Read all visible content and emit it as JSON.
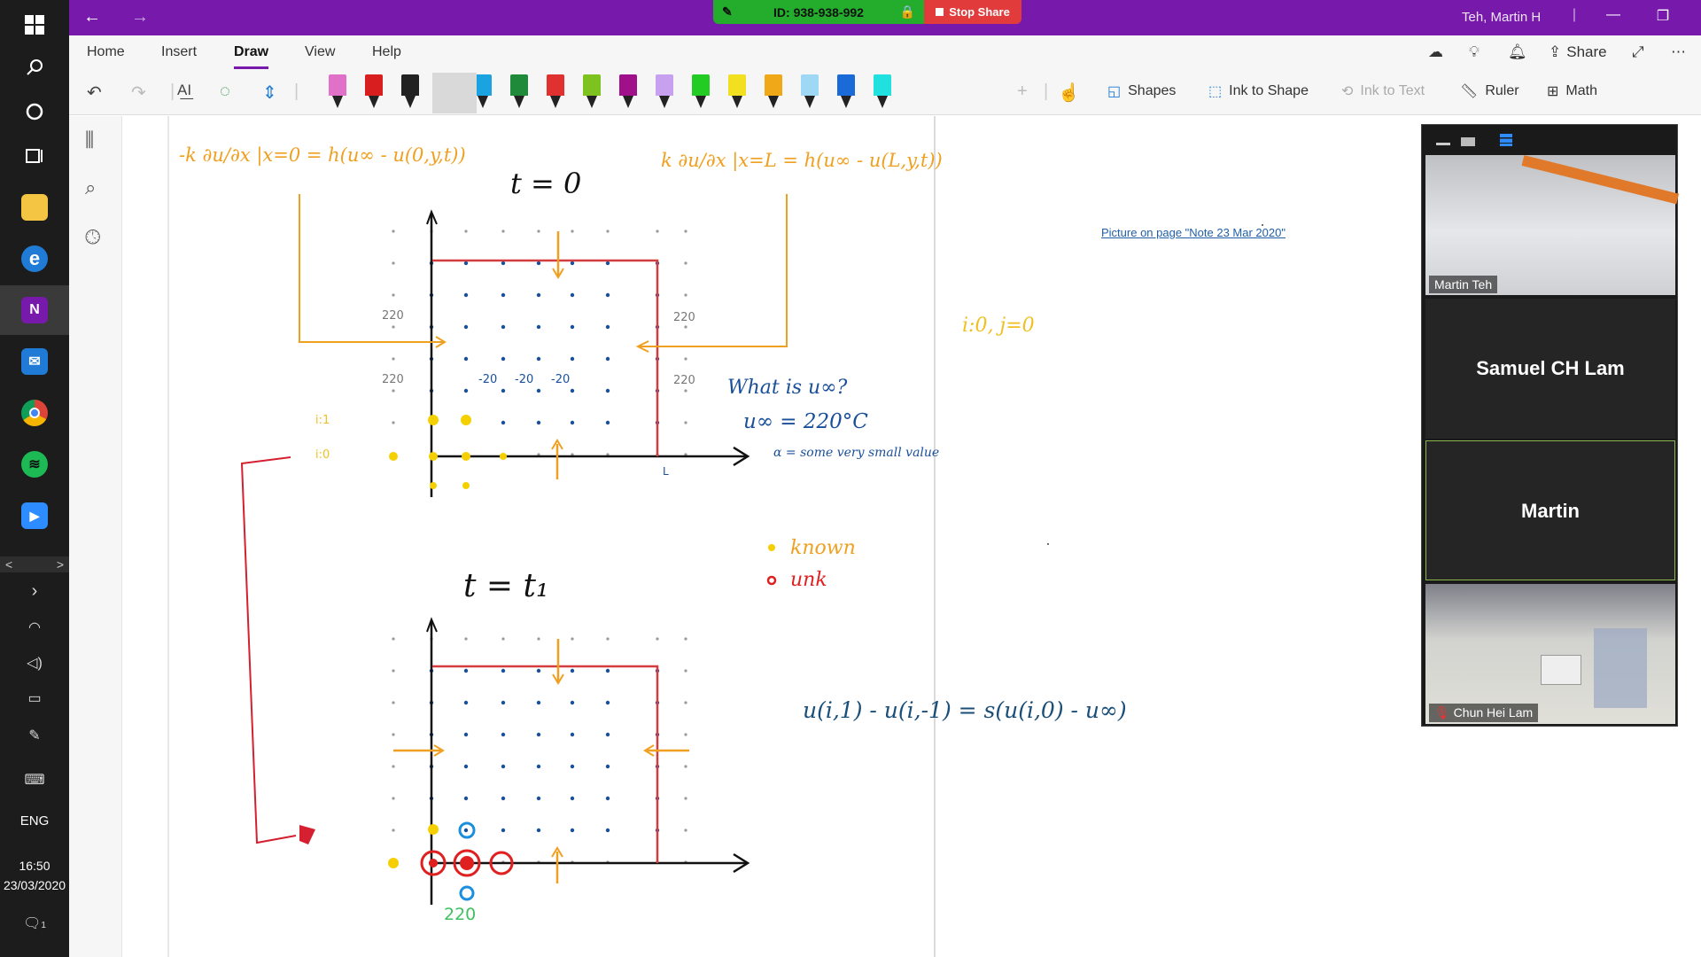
{
  "taskbar": {
    "apps": [
      {
        "name": "start-icon",
        "glyph": "⊞"
      },
      {
        "name": "search-icon",
        "glyph": "⌕"
      },
      {
        "name": "cortana-icon",
        "glyph": "○"
      },
      {
        "name": "task-view-icon",
        "glyph": "❐"
      },
      {
        "name": "file-explorer-icon",
        "color": "#f4c542",
        "glyph": ""
      },
      {
        "name": "edge-icon",
        "color": "#1f7bd6",
        "glyph": "e"
      },
      {
        "name": "onenote-icon",
        "color": "#7719aa",
        "glyph": "N"
      },
      {
        "name": "mail-icon",
        "color": "#1f7bd6",
        "glyph": "✉"
      },
      {
        "name": "chrome-icon",
        "color": "#db4437",
        "glyph": "●"
      },
      {
        "name": "spotify-icon",
        "color": "#1db954",
        "glyph": "≋"
      },
      {
        "name": "zoom-icon",
        "color": "#2d8cff",
        "glyph": "▶"
      }
    ],
    "lang": "ENG",
    "time": "16:50",
    "date": "23/03/2020",
    "notifications": "1"
  },
  "titlebar": {
    "user": "Teh, Martin H",
    "share_id": "ID: 938-938-992",
    "stop_share": "Stop Share"
  },
  "ribbon": {
    "tabs": [
      "Home",
      "Insert",
      "Draw",
      "View",
      "Help"
    ],
    "active_tab": "Draw",
    "share_label": "Share",
    "shapes_label": "Shapes",
    "ink_to_shape_label": "Ink to Shape",
    "ink_to_text_label": "Ink to Text",
    "ruler_label": "Ruler",
    "math_label": "Math",
    "pens": [
      "#e070c8",
      "#d81e1e",
      "#222222",
      "#1a4f8a",
      "#1aa3e0",
      "#1f8a3a",
      "#e03030",
      "#7dc21e",
      "#a0108a",
      "#c8a0f0",
      "#22cc22",
      "#f2e020",
      "#f0a818",
      "#9fd8f5",
      "#1a6ad8",
      "#20e0e0"
    ]
  },
  "canvas": {
    "page_link": "Picture on page \"Note 23 Mar 2020\"",
    "handwritten": {
      "bc_left": "-k ∂u/∂x |x=0 = h(u∞ - u(0,y,t))",
      "bc_right": "k ∂u/∂x |x=L = h(u∞ - u(L,y,t))",
      "t0": "t = 0",
      "t1": "t = t₁",
      "what_is": "What is u∞?",
      "u_inf": "u∞ = 220°C",
      "alpha": "α = some very small value",
      "known": "known",
      "unk": "unk",
      "ij": "i:0, j=0",
      "equation": "u(i,1) - u(i,-1) = s(u(i,0) - u∞)",
      "v220": "220",
      "vneg20": "-20",
      "i1": "i:1",
      "i0": "i:0",
      "L": "L"
    }
  },
  "zoom": {
    "tiles": [
      {
        "name": "Martin Teh",
        "type": "video"
      },
      {
        "name": "Samuel CH Lam",
        "type": "name"
      },
      {
        "name": "Martin",
        "type": "name",
        "active": true
      },
      {
        "name": "Chun Hei Lam",
        "type": "video",
        "muted": true
      }
    ]
  }
}
